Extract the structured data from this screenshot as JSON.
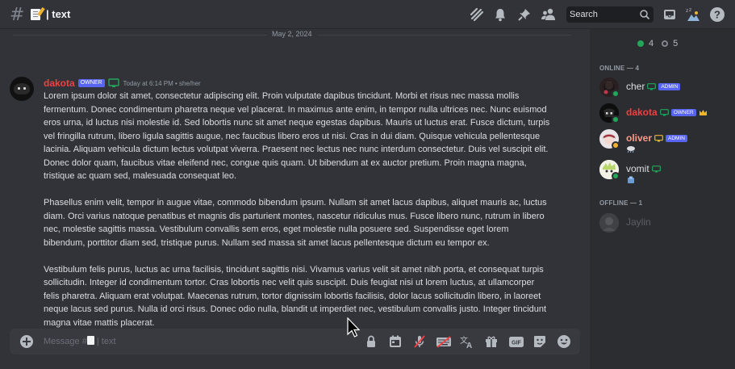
{
  "header": {
    "channel_title": "| text",
    "search_placeholder": "Search"
  },
  "chat": {
    "date_divider": "May 2, 2024",
    "message": {
      "author": "dakota",
      "badge": "OWNER",
      "timestamp": "Today at 6:14 PM • she/her",
      "paragraphs": [
        "Lorem ipsum dolor sit amet, consectetur adipiscing elit. Proin vulputate dapibus tincidunt. Morbi et risus nec massa mollis fermentum. Donec condimentum pharetra neque vel placerat. In maximus ante enim, in tempor nulla ultrices nec. Nunc euismod eros urna, id luctus nisi molestie id. Sed lobortis nunc sit amet neque egestas dapibus. Mauris ut luctus erat. Fusce dictum, turpis vel fringilla rutrum, libero ligula sagittis augue, nec faucibus libero eros ut nisi. Cras in dui diam. Quisque vehicula pellentesque lacinia. Aliquam vehicula dictum lectus volutpat viverra. Praesent nec lectus nec nunc interdum consectetur. Duis vel suscipit elit. Donec dolor quam, faucibus vitae eleifend nec, congue quis quam. Ut bibendum at ex auctor pretium. Proin magna magna, tristique ac quam sed, malesuada consequat leo.",
        "Phasellus enim velit, tempor in augue vitae, commodo bibendum ipsum. Nullam sit amet lacus dapibus, aliquet mauris ac, luctus diam. Orci varius natoque penatibus et magnis dis parturient montes, nascetur ridiculus mus. Fusce libero nunc, rutrum in libero nec, molestie sagittis massa. Vestibulum convallis sem eros, eget molestie nulla posuere sed. Suspendisse eget lorem bibendum, porttitor diam sed, tristique purus. Nullam sed massa sit amet lacus pellentesque dictum eu tempor ex.",
        "Vestibulum felis purus, luctus ac urna facilisis, tincidunt sagittis nisi. Vivamus varius velit sit amet nibh porta, et consequat turpis sollicitudin. Integer id condimentum tortor. Cras lobortis nec velit quis suscipit. Duis feugiat nisi ut lorem luctus, at ullamcorper felis pharetra. Aliquam erat volutpat. Maecenas rutrum, tortor dignissim lobortis facilisis, dolor lacus sollicitudin libero, in laoreet neque lacus sed purus. Nulla id orci risus. Donec odio nulla, blandit ut imperdiet nec, vestibulum convallis justo. Integer tincidunt magna vitae mattis placerat."
      ]
    }
  },
  "composer": {
    "placeholder_prefix": "Message #",
    "placeholder_suffix": " | text"
  },
  "members": {
    "online_count": "4",
    "offline_count": "5",
    "online_header": "ONLINE — 4",
    "offline_header": "OFFLINE — 1",
    "online": [
      {
        "name": "cher",
        "color": "#dbdee1",
        "badge": "ADMIN",
        "status": "online"
      },
      {
        "name": "dakota",
        "color": "#f23f42",
        "badge": "OWNER",
        "status": "online"
      },
      {
        "name": "oliver",
        "color": "#ff9a8a",
        "badge": "ADMIN",
        "status": "idle"
      },
      {
        "name": "vomit",
        "color": "#dbdee1",
        "badge": "",
        "status": "online"
      }
    ],
    "offline": [
      {
        "name": "Jaylin",
        "color": "#5c5f66"
      }
    ]
  },
  "colors": {
    "accent": "#5865f2",
    "online": "#23a55a",
    "idle": "#f0b232",
    "owner_red": "#f23f42"
  }
}
